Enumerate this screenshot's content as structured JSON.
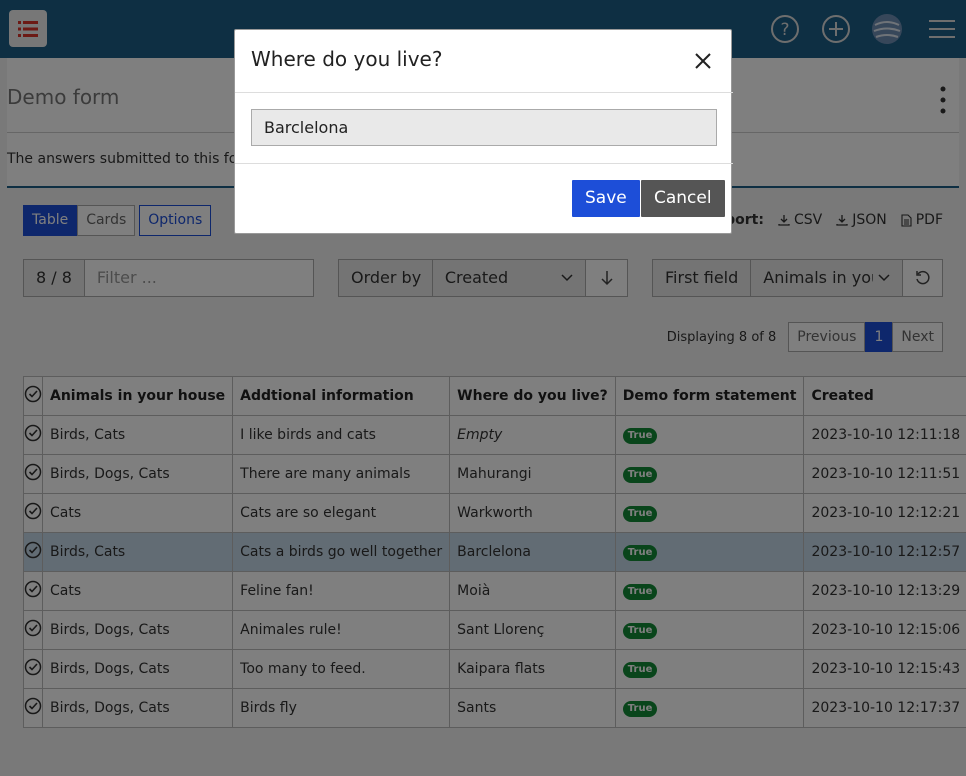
{
  "page": {
    "title": "Demo form",
    "intro": "The answers submitted to this form"
  },
  "view_tabs": {
    "table": "Table",
    "cards": "Cards",
    "options": "Options"
  },
  "export": {
    "label": "Export:",
    "csv": "CSV",
    "json": "JSON",
    "pdf": "PDF"
  },
  "filter": {
    "count": "8 / 8",
    "placeholder": "Filter ..."
  },
  "order": {
    "label": "Order by",
    "value": "Created"
  },
  "first_field": {
    "label": "First field",
    "value": "Animals in your house"
  },
  "pager": {
    "info": "Displaying 8 of 8",
    "previous": "Previous",
    "page": "1",
    "next": "Next"
  },
  "table": {
    "columns": [
      "Animals in your house",
      "Addtional information",
      "Where do you live?",
      "Demo form statement",
      "Created"
    ],
    "rows": [
      [
        "Birds, Cats",
        "I like birds and cats",
        "Empty",
        "True",
        "2023-10-10 12:11:18"
      ],
      [
        "Birds, Dogs, Cats",
        "There are many animals",
        "Mahurangi",
        "True",
        "2023-10-10 12:11:51"
      ],
      [
        "Cats",
        "Cats are so elegant",
        "Warkworth",
        "True",
        "2023-10-10 12:12:21"
      ],
      [
        "Birds, Cats",
        "Cats a birds go well together",
        "Barclelona",
        "True",
        "2023-10-10 12:12:57"
      ],
      [
        "Cats",
        "Feline fan!",
        "Moià",
        "True",
        "2023-10-10 12:13:29"
      ],
      [
        "Birds, Dogs, Cats",
        "Animales rule!",
        "Sant Llorenç",
        "True",
        "2023-10-10 12:15:06"
      ],
      [
        "Birds, Dogs, Cats",
        "Too many to feed.",
        "Kaipara flats",
        "True",
        "2023-10-10 12:15:43"
      ],
      [
        "Birds, Dogs, Cats",
        "Birds fly",
        "Sants",
        "True",
        "2023-10-10 12:17:37"
      ]
    ]
  },
  "modal": {
    "title": "Where do you live?",
    "input_value": "Barclelona",
    "save": "Save",
    "cancel": "Cancel"
  },
  "colors": {
    "topbar": "#1d5f86",
    "primary": "#1d4ed8",
    "badge": "#138a36"
  }
}
